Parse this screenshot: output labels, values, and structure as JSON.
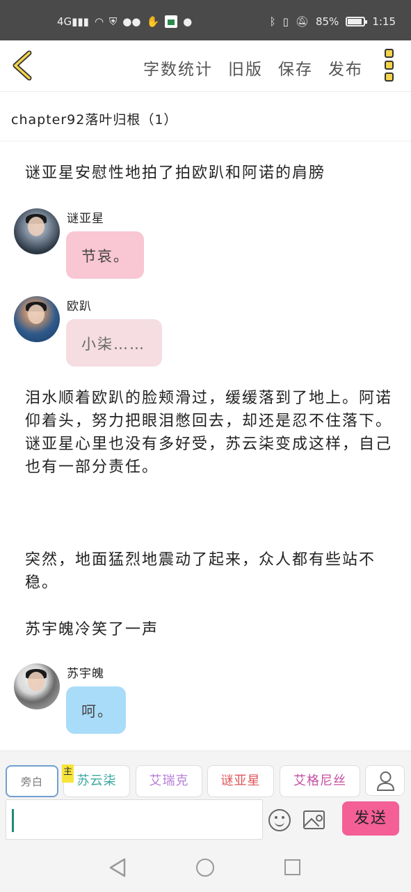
{
  "status_bar": {
    "signal": "4G",
    "battery": "85%",
    "time": "1:15"
  },
  "toolbar": {
    "word_count": "字数统计",
    "old_version": "旧版",
    "save": "保存",
    "publish": "发布"
  },
  "chapter": {
    "title": "chapter92落叶归根（1）"
  },
  "story": {
    "narration_1": "谜亚星安慰性地拍了拍欧趴和阿诺的肩膀",
    "msg_1": {
      "name": "谜亚星",
      "text": "节哀。"
    },
    "msg_2": {
      "name": "欧趴",
      "text": "小柒……"
    },
    "narration_2": "泪水顺着欧趴的脸颊滑过，缓缓落到了地上。阿诺仰着头，努力把眼泪憋回去，却还是忍不住落下。谜亚星心里也没有多好受，苏云柒变成这样，自己也有一部分责任。",
    "narration_3": "突然，地面猛烈地震动了起来，众人都有些站不稳。",
    "narration_4": "苏宇魄冷笑了一声",
    "msg_3": {
      "name": "苏宇魄",
      "text": "呵。"
    }
  },
  "roles": {
    "narrator": "旁白",
    "main_tag": "主",
    "role_1": "苏云柒",
    "role_2": "艾瑞克",
    "role_3": "谜亚星",
    "role_4": "艾格尼丝"
  },
  "input": {
    "send": "发送"
  },
  "colors": {
    "role_1": "#3aa8a0",
    "role_2": "#b77fd6",
    "role_3": "#e0555a",
    "role_4": "#c64fa2"
  }
}
